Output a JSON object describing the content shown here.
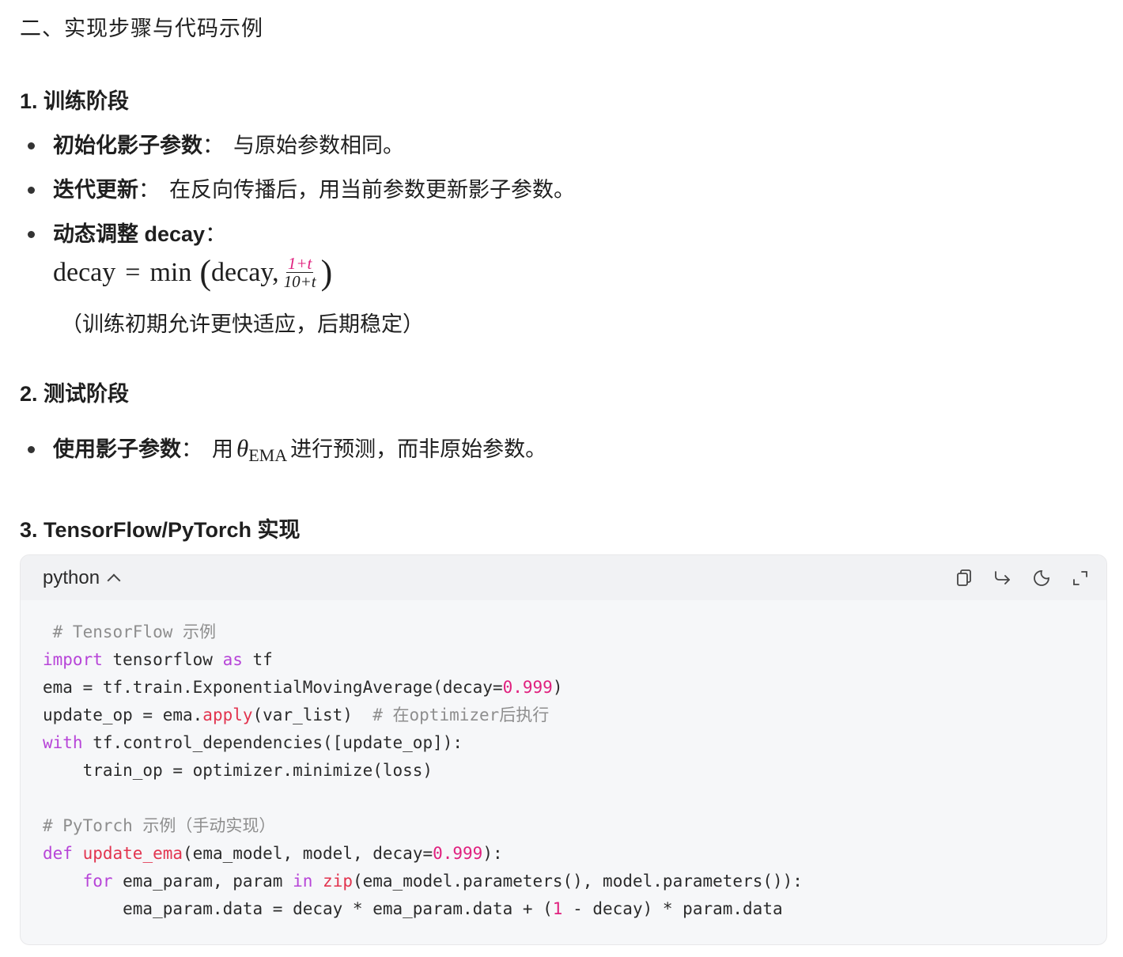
{
  "section_title": "二、实现步骤与代码示例",
  "step1": {
    "heading": "1. 训练阶段",
    "bullets": [
      {
        "term": "初始化影子参数",
        "colon": "：",
        "text": "与原始参数相同。"
      },
      {
        "term": "迭代更新",
        "colon": "：",
        "text": "在反向传播后，用当前参数更新影子参数。"
      },
      {
        "term": "动态调整 decay",
        "colon": "：",
        "text": ""
      }
    ],
    "formula": {
      "lhs": "decay",
      "eq": "=",
      "fn": "min",
      "arg": "decay,",
      "num": "1+t",
      "den": "10+t"
    },
    "note": "（训练初期允许更快适应，后期稳定）"
  },
  "step2": {
    "heading": "2. 测试阶段",
    "bullet": {
      "term": "使用影子参数",
      "colon": "：",
      "pre": "用",
      "symbol": "θ",
      "subscript": "EMA",
      "post": "进行预测，而非原始参数。"
    }
  },
  "step3": {
    "heading": "3. TensorFlow/PyTorch 实现"
  },
  "code_block": {
    "language": "python",
    "toolbar_icons": [
      "copy-icon",
      "share-icon",
      "theme-moon-icon",
      "expand-icon"
    ],
    "lines": [
      [
        {
          "t": " # TensorFlow 示例",
          "c": "cm"
        }
      ],
      [
        {
          "t": "import",
          "c": "kw"
        },
        {
          "t": " tensorflow ",
          "c": ""
        },
        {
          "t": "as",
          "c": "kw"
        },
        {
          "t": " tf",
          "c": ""
        }
      ],
      [
        {
          "t": "ema = tf.train.ExponentialMovingAverage(decay=",
          "c": ""
        },
        {
          "t": "0.999",
          "c": "num"
        },
        {
          "t": ")",
          "c": ""
        }
      ],
      [
        {
          "t": "update_op = ema.",
          "c": ""
        },
        {
          "t": "apply",
          "c": "fn"
        },
        {
          "t": "(var_list)  ",
          "c": ""
        },
        {
          "t": "# 在optimizer后执行",
          "c": "cm"
        }
      ],
      [
        {
          "t": "with",
          "c": "kw"
        },
        {
          "t": " tf.control_dependencies([update_op]):",
          "c": ""
        }
      ],
      [
        {
          "t": "    train_op = optimizer.minimize(loss)",
          "c": ""
        }
      ],
      [
        {
          "t": "",
          "c": ""
        }
      ],
      [
        {
          "t": "# PyTorch 示例（手动实现）",
          "c": "cm"
        }
      ],
      [
        {
          "t": "def",
          "c": "kw"
        },
        {
          "t": " ",
          "c": ""
        },
        {
          "t": "update_ema",
          "c": "fn"
        },
        {
          "t": "(ema_model, model, decay=",
          "c": ""
        },
        {
          "t": "0.999",
          "c": "num"
        },
        {
          "t": "):",
          "c": ""
        }
      ],
      [
        {
          "t": "    ",
          "c": ""
        },
        {
          "t": "for",
          "c": "kw"
        },
        {
          "t": " ema_param, param ",
          "c": ""
        },
        {
          "t": "in",
          "c": "kw"
        },
        {
          "t": " ",
          "c": ""
        },
        {
          "t": "zip",
          "c": "fn"
        },
        {
          "t": "(ema_model.parameters(), model.parameters()):",
          "c": ""
        }
      ],
      [
        {
          "t": "        ema_param.data = decay * ema_param.data + (",
          "c": ""
        },
        {
          "t": "1",
          "c": "num"
        },
        {
          "t": " - decay) * param.data",
          "c": ""
        }
      ]
    ]
  }
}
